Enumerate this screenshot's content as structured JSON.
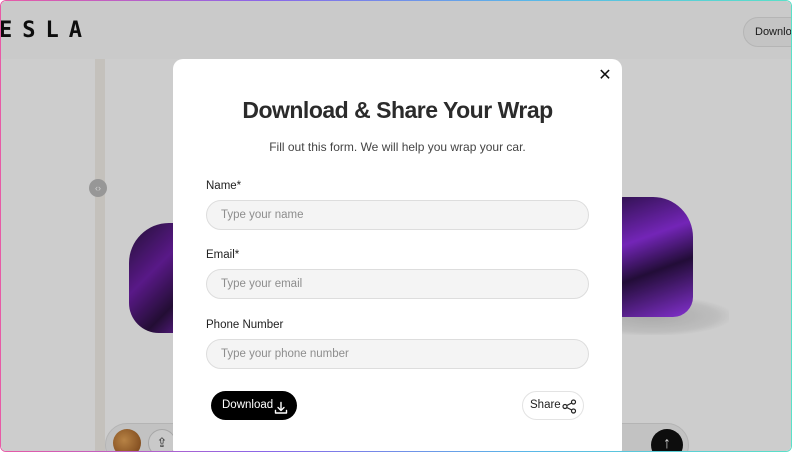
{
  "app": {
    "logo_text": "ESLA",
    "top_download_label": "Download"
  },
  "modal": {
    "title": "Download & Share Your Wrap",
    "subtitle": "Fill out this form. We will help you wrap your car.",
    "fields": [
      {
        "label": "Name*",
        "placeholder": "Type your name",
        "value": ""
      },
      {
        "label": "Email*",
        "placeholder": "Type your email",
        "value": ""
      },
      {
        "label": "Phone Number",
        "placeholder": "Type your phone number",
        "value": ""
      }
    ],
    "download_label": "Download",
    "share_label": "Share"
  },
  "icons": {
    "close": "close-icon",
    "download": "download-icon",
    "share": "share-icon",
    "upload": "upload-icon",
    "send": "arrow-up-icon",
    "compare": "compare-handle-icon"
  },
  "colors": {
    "primary_button": "#000000",
    "wrap_accent": "#8d2ee0",
    "input_bg": "#f4f4f4"
  }
}
